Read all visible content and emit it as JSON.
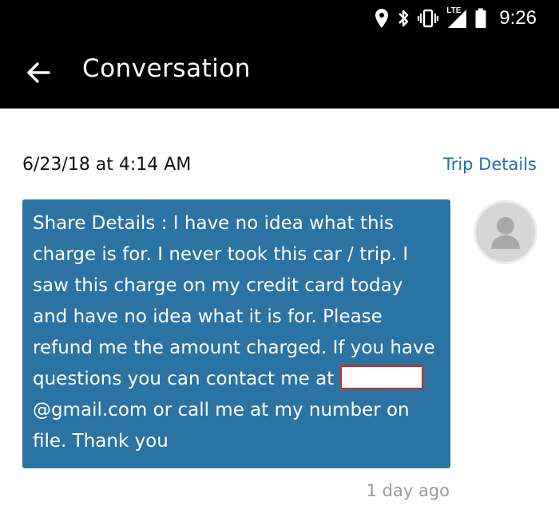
{
  "status_bar": {
    "time": "9:26",
    "network_label": "LTE",
    "icons": [
      "location-icon",
      "bluetooth-icon",
      "vibrate-icon",
      "lte-signal-icon",
      "battery-icon"
    ]
  },
  "app_bar": {
    "title": "Conversation",
    "back_icon": "arrow-left-icon"
  },
  "conversation": {
    "date": "6/23/18 at 4:14 AM",
    "trip_details_label": "Trip Details",
    "message": {
      "label": "Share Details",
      "separator": " : ",
      "body_part1": "I have no idea what this charge is for. I never took this car / trip. I saw this charge on my credit card today and have no idea what it is for. Please refund me the amount charged. If you have questions you can contact me at",
      "email_suffix": "@gmail.com",
      "body_part2": " or call me at my number on file. Thank you",
      "timestamp": "1 day ago"
    },
    "avatar_icon": "user-avatar-icon"
  },
  "colors": {
    "bubble": "#2b73a3",
    "link": "#1f6fa8",
    "redaction_border": "#e0241d",
    "header_bg": "#000000"
  }
}
